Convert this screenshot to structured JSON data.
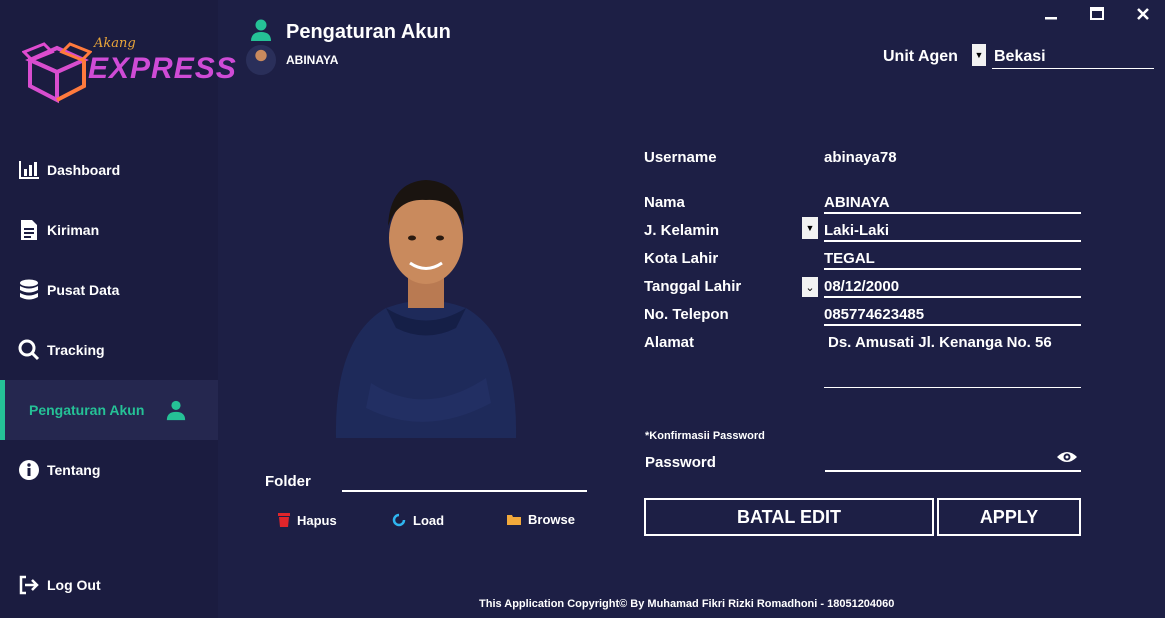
{
  "brand": {
    "script": "Akang",
    "name": "EXPRESS"
  },
  "window": {
    "minimize": "—",
    "maximize": "▭",
    "close": "✕"
  },
  "header": {
    "title": "Pengaturan Akun",
    "username": "ABINAYA"
  },
  "unit_agen": {
    "label": "Unit Agen",
    "value": "Bekasi"
  },
  "sidebar": {
    "items": [
      {
        "label": "Dashboard",
        "icon": "bar-chart-icon"
      },
      {
        "label": "Kiriman",
        "icon": "document-icon"
      },
      {
        "label": "Pusat Data",
        "icon": "database-icon"
      },
      {
        "label": "Tracking",
        "icon": "search-icon"
      },
      {
        "label": "Pengaturan Akun",
        "icon": "user-icon",
        "active": true
      },
      {
        "label": "Tentang",
        "icon": "info-icon"
      }
    ],
    "logout": {
      "label": "Log Out",
      "icon": "logout-icon"
    }
  },
  "folder": {
    "label": "Folder",
    "value": ""
  },
  "photo_actions": {
    "hapus": "Hapus",
    "load": "Load",
    "browse": "Browse"
  },
  "form": {
    "username_label": "Username",
    "username_value": "abinaya78",
    "nama_label": "Nama",
    "nama_value": "ABINAYA",
    "kelamin_label": "J. Kelamin",
    "kelamin_value": "Laki-Laki",
    "kota_label": "Kota Lahir",
    "kota_value": "TEGAL",
    "tanggal_label": "Tanggal Lahir",
    "tanggal_value": "08/12/2000",
    "telepon_label": "No. Telepon",
    "telepon_value": "085774623485",
    "alamat_label": "Alamat",
    "alamat_value": "Ds. Amusati Jl. Kenanga No. 56",
    "konfirmasi_label": "*Konfirmasii Password",
    "password_label": "Password",
    "password_value": ""
  },
  "buttons": {
    "batal_edit": "BATAL EDIT",
    "apply": "APPLY"
  },
  "footer": "This Application Copyright© By Muhamad Fikri Rizki Romadhoni - 18051204060",
  "colors": {
    "background": "#1d1f45",
    "sidebar": "#1b1c40",
    "accent": "#25c196",
    "delete": "#e0252b",
    "load": "#2fb5f0",
    "browse": "#f2a93b"
  }
}
